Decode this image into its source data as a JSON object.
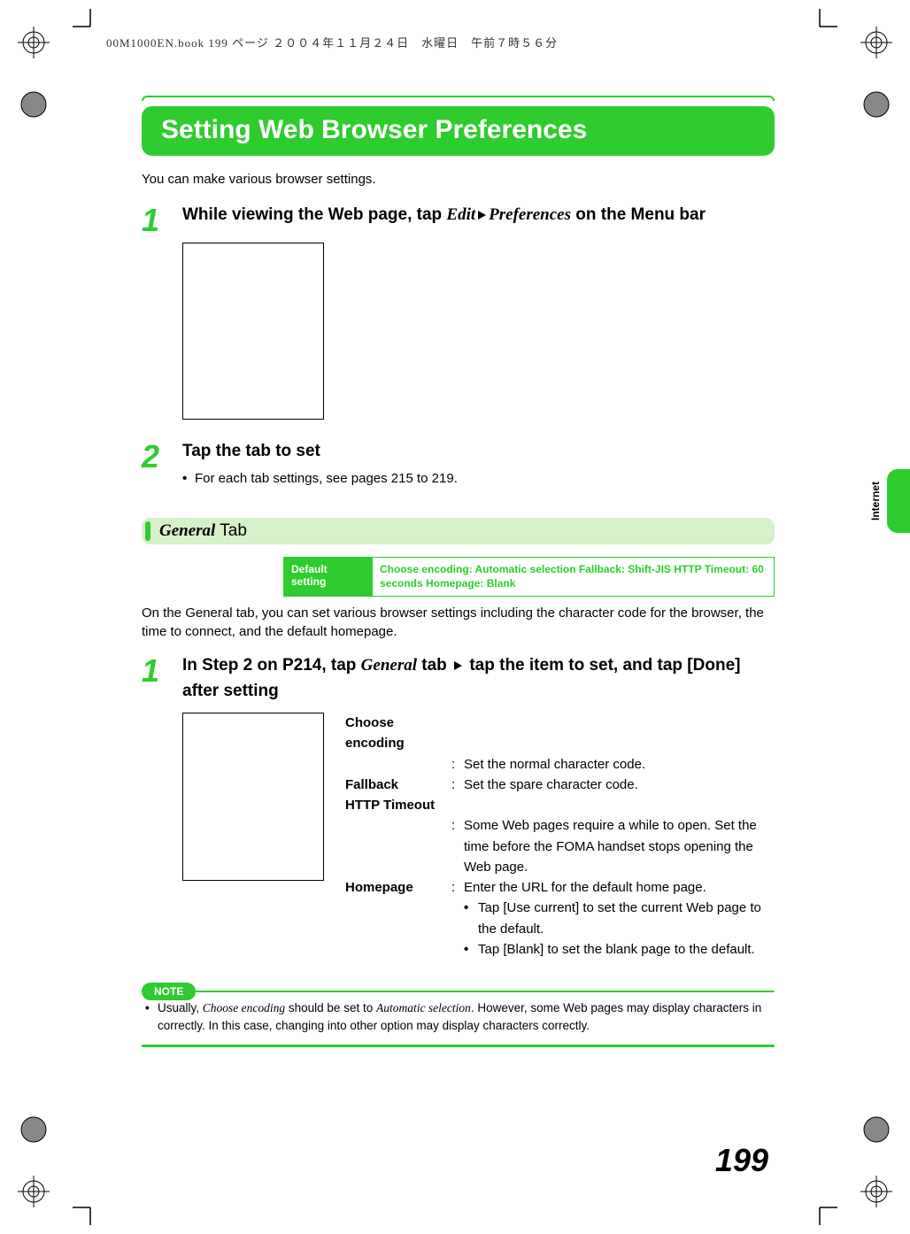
{
  "meta": {
    "header": "00M1000EN.book  199 ページ  ２００４年１１月２４日　水曜日　午前７時５６分"
  },
  "title": "Setting Web Browser Preferences",
  "intro": "You can make various browser settings.",
  "step1": {
    "num": "1",
    "title_a": "While viewing the Web page, tap ",
    "title_b": "Edit",
    "title_c": "Preferences",
    "title_d": " on the Menu bar"
  },
  "step2": {
    "num": "2",
    "title": "Tap the tab to set",
    "bullet": "For each tab settings, see pages 215 to 219."
  },
  "section": {
    "name_italic": "General",
    "name_rest": " Tab"
  },
  "default_setting": {
    "label": "Default setting",
    "value": "Choose encoding: Automatic selection Fallback: Shift-JIS HTTP Timeout: 60 seconds Homepage: Blank"
  },
  "section_para": "On the General tab, you can set various browser settings including the character code for the browser, the time to connect, and the default homepage.",
  "step3": {
    "num": "1",
    "title_a": "In Step 2 on P214, tap ",
    "title_b": "General",
    "title_c": " tab ",
    "title_d": " tap the item to set, and tap [Done] after setting"
  },
  "defs": {
    "choose_encoding_term": "Choose encoding",
    "choose_encoding_desc": "Set the normal character code.",
    "fallback_term": "Fallback",
    "fallback_desc": "Set the spare character code.",
    "http_timeout_term": "HTTP Timeout",
    "http_timeout_desc": "Some Web pages require a while to open. Set the time before the FOMA handset stops opening the Web page.",
    "homepage_term": "Homepage",
    "homepage_desc": "Enter the URL for the default home page.",
    "homepage_sub1": "Tap [Use current] to set the current Web page to the default.",
    "homepage_sub2": "Tap [Blank] to set the blank page to the default."
  },
  "note": {
    "label": "NOTE",
    "text_a": "Usually, ",
    "text_b": "Choose encoding",
    "text_c": " should be set to ",
    "text_d": "Automatic selection",
    "text_e": ". However, some Web pages may display characters in correctly. In this case, changing into other option may display characters correctly."
  },
  "side_label": "Internet",
  "page_number": "199"
}
